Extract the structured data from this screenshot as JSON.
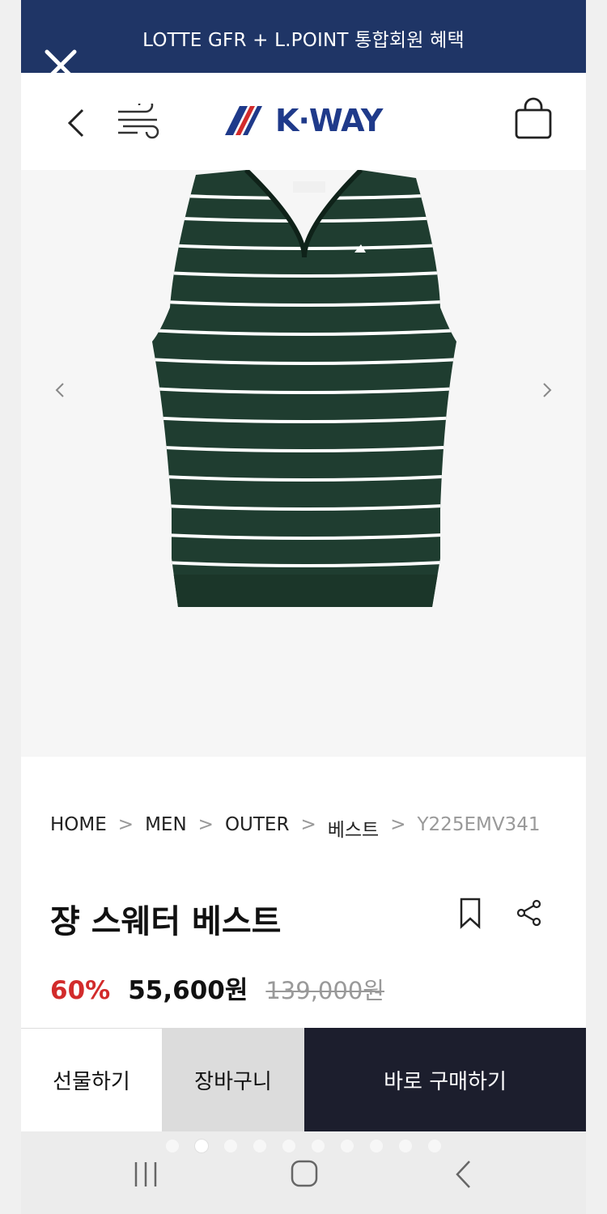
{
  "banner": {
    "text": "LOTTE GFR + L.POINT 통합회원 혜택"
  },
  "header": {
    "back_icon": "chevron-left-icon",
    "menu_icon": "wind-menu-icon",
    "logo": "K·WAY",
    "cart_icon": "shopping-bag-icon"
  },
  "gallery": {
    "product_image": "striped-sweater-vest",
    "colors": {
      "vest": "#1f3d30",
      "stripe": "#ffffff",
      "background": "#f6f6f6"
    }
  },
  "breadcrumb": {
    "items": [
      "HOME",
      "MEN",
      "OUTER",
      "베스트",
      "Y225EMV341"
    ],
    "separator": ">"
  },
  "product": {
    "title": "쟝 스웨터 베스트",
    "discount": "60%",
    "price": "55,600원",
    "original_price": "139,000원"
  },
  "actions": {
    "gift": "선물하기",
    "cart": "장바구니",
    "buy": "바로 구매하기"
  },
  "system_nav": {
    "recents": "recents-icon",
    "home": "home-icon",
    "back": "back-icon"
  },
  "colors": {
    "banner": "#1f3566",
    "discount": "#d22b2b",
    "buy_button": "#1c1e2d",
    "cart_button": "#dcdcdc",
    "logo": "#1f3a8a"
  }
}
